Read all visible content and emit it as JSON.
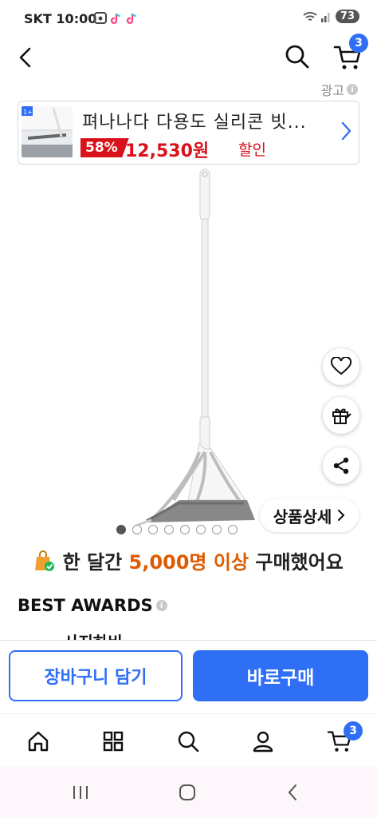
{
  "status": {
    "carrier": "SKT",
    "time": "10:00",
    "battery": "73"
  },
  "header": {
    "cart_count": "3"
  },
  "ad": {
    "label": "광고",
    "title": "펴나나다 다용도 실리콘 빗...",
    "discount": "58%",
    "price": "12,530원",
    "sale_label": "할인"
  },
  "product": {
    "detail_button": "상품상세",
    "image_page_count": 8,
    "active_page": 1
  },
  "purchase_info": {
    "prefix": "한 달간 ",
    "highlight": "5,000명 이상",
    "suffix": " 구매했어요"
  },
  "awards": {
    "title": "BEST AWARDS",
    "partial_text": "사지하비"
  },
  "actions": {
    "cart_button": "장바구니 담기",
    "buy_button": "바로구매"
  },
  "bottom_nav": {
    "cart_count": "3"
  },
  "colors": {
    "accent": "#2f6ff5",
    "discount_red": "#d9111a",
    "highlight_orange": "#e05a00"
  }
}
